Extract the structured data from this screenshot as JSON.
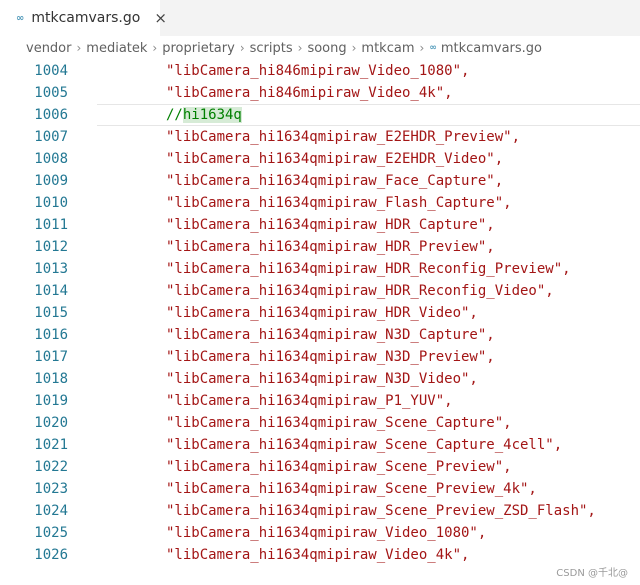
{
  "tab": {
    "icon": "go-file-icon",
    "title": "mtkcamvars.go",
    "close": "×"
  },
  "breadcrumb": {
    "items": [
      "vendor",
      "mediatek",
      "proprietary",
      "scripts",
      "soong",
      "mtkcam"
    ],
    "file": "mtkcamvars.go",
    "separator": "›"
  },
  "editor": {
    "lines": [
      {
        "num": "1004",
        "text": "\"libCamera_hi846mipiraw_Video_1080\","
      },
      {
        "num": "1005",
        "text": "\"libCamera_hi846mipiraw_Video_4k\","
      },
      {
        "num": "1006",
        "text": "//hi1634q",
        "comment": true
      },
      {
        "num": "1007",
        "text": "\"libCamera_hi1634qmipiraw_E2EHDR_Preview\","
      },
      {
        "num": "1008",
        "text": "\"libCamera_hi1634qmipiraw_E2EHDR_Video\","
      },
      {
        "num": "1009",
        "text": "\"libCamera_hi1634qmipiraw_Face_Capture\","
      },
      {
        "num": "1010",
        "text": "\"libCamera_hi1634qmipiraw_Flash_Capture\","
      },
      {
        "num": "1011",
        "text": "\"libCamera_hi1634qmipiraw_HDR_Capture\","
      },
      {
        "num": "1012",
        "text": "\"libCamera_hi1634qmipiraw_HDR_Preview\","
      },
      {
        "num": "1013",
        "text": "\"libCamera_hi1634qmipiraw_HDR_Reconfig_Preview\","
      },
      {
        "num": "1014",
        "text": "\"libCamera_hi1634qmipiraw_HDR_Reconfig_Video\","
      },
      {
        "num": "1015",
        "text": "\"libCamera_hi1634qmipiraw_HDR_Video\","
      },
      {
        "num": "1016",
        "text": "\"libCamera_hi1634qmipiraw_N3D_Capture\","
      },
      {
        "num": "1017",
        "text": "\"libCamera_hi1634qmipiraw_N3D_Preview\","
      },
      {
        "num": "1018",
        "text": "\"libCamera_hi1634qmipiraw_N3D_Video\","
      },
      {
        "num": "1019",
        "text": "\"libCamera_hi1634qmipiraw_P1_YUV\","
      },
      {
        "num": "1020",
        "text": "\"libCamera_hi1634qmipiraw_Scene_Capture\","
      },
      {
        "num": "1021",
        "text": "\"libCamera_hi1634qmipiraw_Scene_Capture_4cell\","
      },
      {
        "num": "1022",
        "text": "\"libCamera_hi1634qmipiraw_Scene_Preview\","
      },
      {
        "num": "1023",
        "text": "\"libCamera_hi1634qmipiraw_Scene_Preview_4k\","
      },
      {
        "num": "1024",
        "text": "\"libCamera_hi1634qmipiraw_Scene_Preview_ZSD_Flash\","
      },
      {
        "num": "1025",
        "text": "\"libCamera_hi1634qmipiraw_Video_1080\","
      },
      {
        "num": "1026",
        "text": "\"libCamera_hi1634qmipiraw_Video_4k\","
      }
    ]
  },
  "watermark": "CSDN @千北@",
  "colors": {
    "string": "#a31515",
    "comment": "#008000",
    "line_number": "#237893"
  }
}
